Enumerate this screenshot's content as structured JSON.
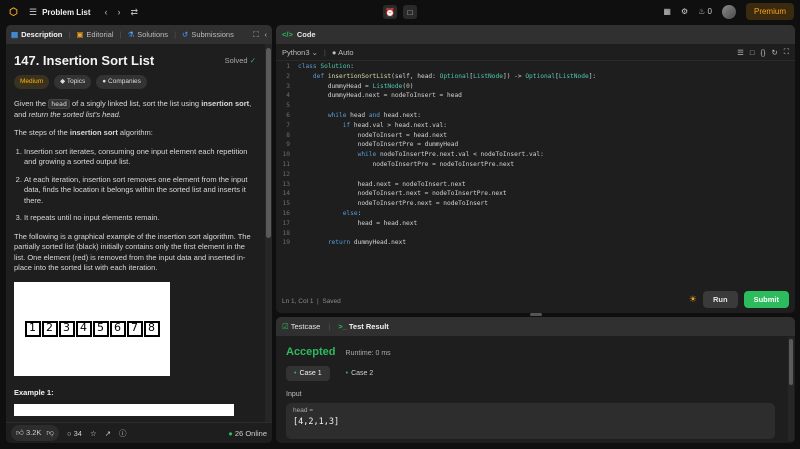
{
  "topbar": {
    "title": "Problem List",
    "streak_count": "0",
    "premium_label": "Premium"
  },
  "left_tabs": {
    "description": "Description",
    "editorial": "Editorial",
    "solutions": "Solutions",
    "submissions": "Submissions"
  },
  "problem": {
    "title": "147. Insertion Sort List",
    "status": "Solved",
    "difficulty": "Medium",
    "topics_label": "Topics",
    "companies_label": "Companies",
    "intro_1": "Given the",
    "intro_code": "head",
    "intro_2": "of a singly linked list, sort the list using",
    "intro_bold": "insertion sort",
    "intro_3": ", and",
    "intro_italic": "return the sorted list's head.",
    "steps_intro_1": "The steps of the",
    "steps_intro_bold": "insertion sort",
    "steps_intro_2": "algorithm:",
    "steps": [
      "Insertion sort iterates, consuming one input element each repetition and growing a sorted output list.",
      "At each iteration, insertion sort removes one element from the input data, finds the location it belongs within the sorted list and inserts it there.",
      "It repeats until no input elements remain."
    ],
    "graphic_text": "The following is a graphical example of the insertion sort algorithm. The partially sorted list (black) initially contains only the first element in the list. One element (red) is removed from the input data and inserted in-place into the sorted list with each iteration.",
    "graphic_cells": [
      "1",
      "2",
      "3",
      "4",
      "5",
      "6",
      "7",
      "8"
    ],
    "example_label": "Example 1:"
  },
  "footer": {
    "likes": "3.2K",
    "comments": "34",
    "online": "26 Online"
  },
  "code_panel": {
    "title": "Code",
    "language": "Python3",
    "auto_label": "Auto",
    "cursor": "Ln 1, Col 1",
    "saved": "Saved",
    "run_label": "Run",
    "submit_label": "Submit",
    "lines": [
      "class Solution:",
      "    def insertionSortList(self, head: Optional[ListNode]) -> Optional[ListNode]:",
      "        dummyHead = ListNode(0)",
      "        dummyHead.next = nodeToInsert = head",
      "",
      "        while head and head.next:",
      "            if head.val > head.next.val:",
      "                nodeToInsert = head.next",
      "                nodeToInsertPre = dummyHead",
      "                while nodeToInsertPre.next.val < nodeToInsert.val:",
      "                    nodeToInsertPre = nodeToInsertPre.next",
      "",
      "                head.next = nodeToInsert.next",
      "                nodeToInsert.next = nodeToInsertPre.next",
      "                nodeToInsertPre.next = nodeToInsert",
      "            else:",
      "                head = head.next",
      "",
      "        return dummyHead.next"
    ]
  },
  "test_panel": {
    "testcase_tab": "Testcase",
    "result_tab": "Test Result",
    "verdict": "Accepted",
    "runtime": "Runtime: 0 ms",
    "cases": [
      "Case 1",
      "Case 2"
    ],
    "input_label": "Input",
    "input_var": "head =",
    "input_value": "[4,2,1,3]"
  },
  "colors": {
    "accent_green": "#2cbb5d",
    "premium_orange": "#ffa116",
    "medium_yellow": "#ffb800"
  }
}
